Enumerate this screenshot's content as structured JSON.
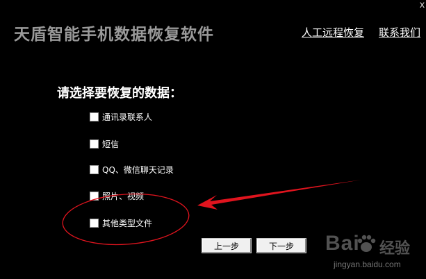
{
  "window": {
    "title": "天盾智能手机数据恢复软件",
    "close_label": "x"
  },
  "header_links": {
    "remote_recovery": "人工远程恢复",
    "contact_us": "联系我们"
  },
  "prompt": "请选择要恢复的数据：",
  "options": [
    {
      "label": "通讯录联系人",
      "checked": false
    },
    {
      "label": "短信",
      "checked": false
    },
    {
      "label": "QQ、微信聊天记录",
      "checked": false
    },
    {
      "label": "照片、视频",
      "checked": false
    },
    {
      "label": "其他类型文件",
      "checked": false
    }
  ],
  "buttons": {
    "prev": "上一步",
    "next": "下一步"
  },
  "annotation": {
    "color": "#e0141e"
  },
  "watermark": {
    "brand_left": "Bai",
    "brand_right": "经验",
    "url": "jingyan.baidu.com"
  }
}
